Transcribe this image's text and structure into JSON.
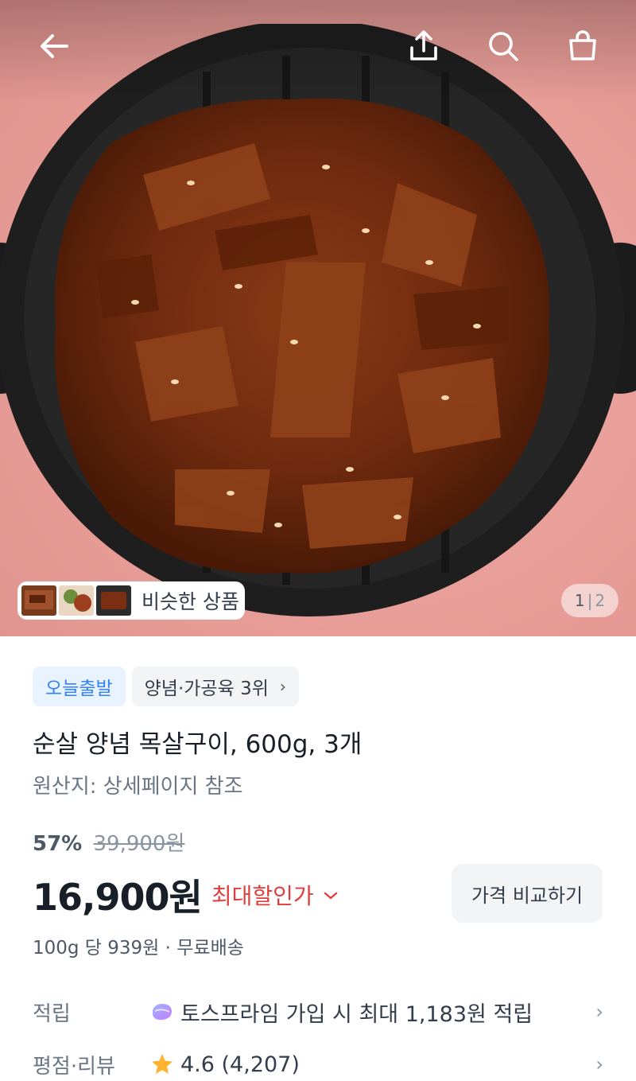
{
  "hero": {
    "similar_label": "비슷한 상품",
    "page_current": "1",
    "page_separator": "|",
    "page_total": "2"
  },
  "topbar": {
    "icons": [
      "back-arrow-icon",
      "share-icon",
      "search-icon",
      "cart-icon"
    ]
  },
  "badges": {
    "delivery": "오늘출발",
    "ranking": "양념·가공육 3위",
    "ranking_chevron": "›"
  },
  "product": {
    "title": "순살 양념 목살구이, 600g, 3개",
    "origin": "원산지: 상세페이지 참조"
  },
  "pricing": {
    "discount_rate": "57%",
    "original_price": "39,900원",
    "price": "16,900원",
    "max_discount_label": "최대할인가",
    "max_discount_chevron": "⌄",
    "compare_button": "가격 비교하기",
    "unit_price": "100g 당 939원 · 무료배송"
  },
  "info_rows": {
    "points_label": "적립",
    "points_value": "토스프라임 가입 시 최대 1,183원 적립",
    "rating_label": "평점·리뷰",
    "rating_value": "4.6 (4,207)",
    "chevron": "›"
  },
  "colors": {
    "accent_blue": "#3182f6",
    "discount_red": "#e03e3e",
    "star": "#ffb331",
    "background_pink": "#eaa09a"
  }
}
